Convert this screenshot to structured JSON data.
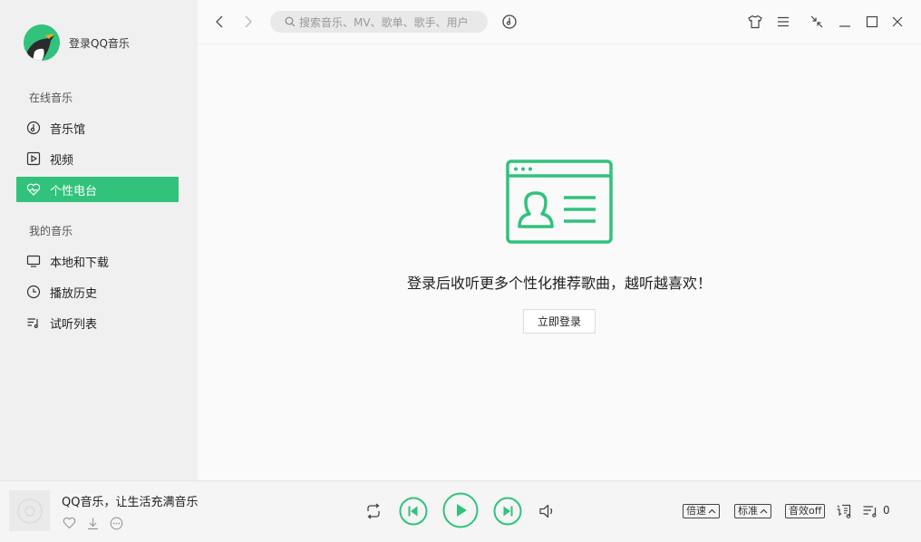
{
  "sidebar": {
    "user_label": "登录QQ音乐",
    "online_title": "在线音乐",
    "online_items": [
      {
        "label": "音乐馆",
        "icon": "music-hall-icon"
      },
      {
        "label": "视频",
        "icon": "video-icon"
      },
      {
        "label": "个性电台",
        "icon": "heart-radio-icon",
        "active": true
      }
    ],
    "my_title": "我的音乐",
    "my_items": [
      {
        "label": "本地和下载",
        "icon": "monitor-icon"
      },
      {
        "label": "播放历史",
        "icon": "clock-icon"
      },
      {
        "label": "试听列表",
        "icon": "playlist-icon"
      }
    ]
  },
  "topbar": {
    "search_placeholder": "搜索音乐、MV、歌单、歌手、用户"
  },
  "main": {
    "promo_text": "登录后收听更多个性化推荐歌曲，越听越喜欢！",
    "login_button": "立即登录"
  },
  "player": {
    "song_title": "QQ音乐，让生活充满音乐",
    "speed_label": "倍速",
    "quality_label": "标准",
    "effect_label": "音效off",
    "playlist_count": "0"
  },
  "colors": {
    "accent": "#31c27c"
  }
}
